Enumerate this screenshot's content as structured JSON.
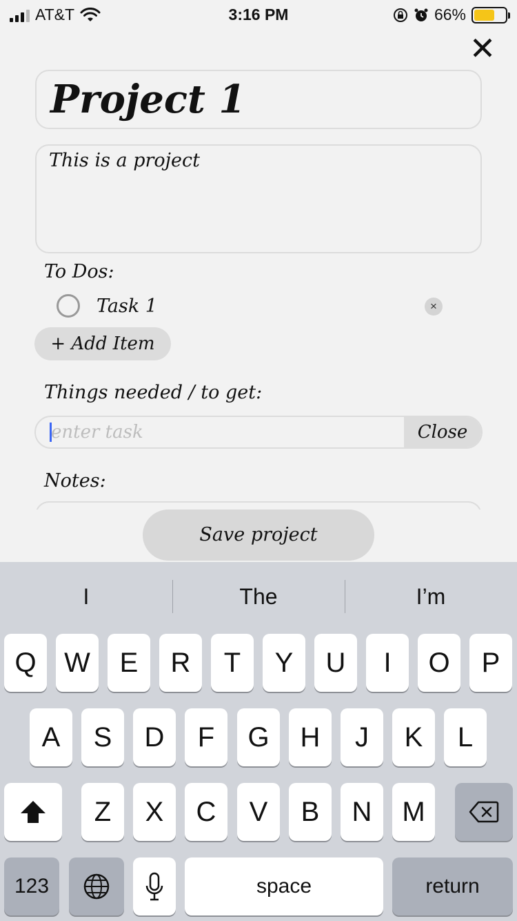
{
  "status_bar": {
    "carrier": "AT&T",
    "time": "3:16 PM",
    "battery": "66%",
    "battery_level": 0.66,
    "icons": [
      "signal-icon",
      "wifi-icon",
      "orientation-lock-icon",
      "alarm-icon",
      "battery-charging-icon"
    ]
  },
  "form": {
    "close_glyph": "✕",
    "title": "Project 1",
    "description": "This is a project",
    "todos_label": "To Dos:",
    "todos": [
      {
        "text": "Task 1",
        "done": false,
        "remove_glyph": "×"
      }
    ],
    "add_item_label": "+ Add Item",
    "things_label": "Things needed / to get:",
    "task_input_placeholder": "enter task",
    "task_close_label": "Close",
    "notes_label": "Notes:",
    "save_label": "Save project"
  },
  "keyboard": {
    "suggestions": [
      "I",
      "The",
      "I’m"
    ],
    "row1": [
      "Q",
      "W",
      "E",
      "R",
      "T",
      "Y",
      "U",
      "I",
      "O",
      "P"
    ],
    "row2": [
      "A",
      "S",
      "D",
      "F",
      "G",
      "H",
      "J",
      "K",
      "L"
    ],
    "row3": [
      "Z",
      "X",
      "C",
      "V",
      "B",
      "N",
      "M"
    ],
    "numbers_label": "123",
    "space_label": "space",
    "return_label": "return"
  }
}
